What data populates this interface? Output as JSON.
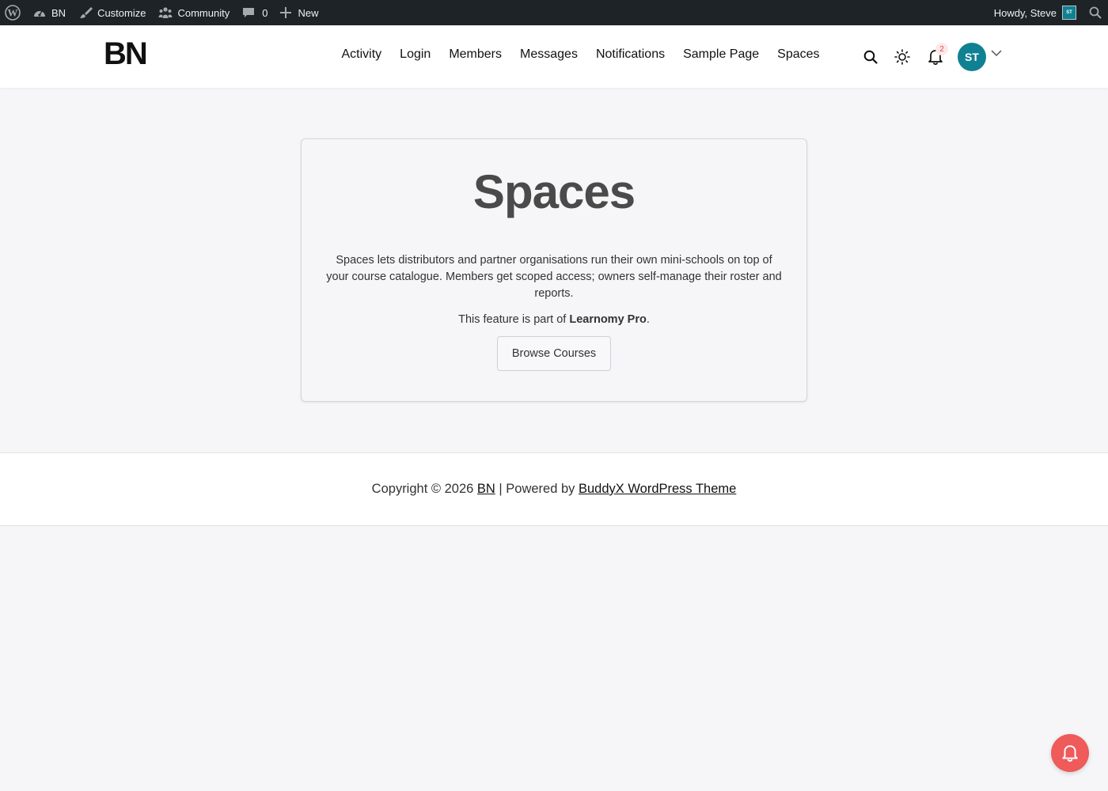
{
  "admin_bar": {
    "site_name": "BN",
    "customize_label": "Customize",
    "community_label": "Community",
    "comments_count": "0",
    "new_label": "New",
    "howdy_text": "Howdy, Steve",
    "avatar_initials": "ST"
  },
  "header": {
    "logo": "BN",
    "nav": [
      "Activity",
      "Login",
      "Members",
      "Messages",
      "Notifications",
      "Sample Page",
      "Spaces"
    ],
    "notifications_count": "2",
    "user_initials": "ST"
  },
  "card": {
    "title": "Spaces",
    "description": "Spaces lets distributors and partner organisations run their own mini-schools on top of your course catalogue. Members get scoped access; owners self-manage their roster and reports.",
    "note_prefix": "This feature is part of ",
    "note_product": "Learnomy Pro",
    "note_suffix": ".",
    "button_label": "Browse Courses"
  },
  "footer": {
    "copyright_prefix": "Copyright © 2026 ",
    "site_link": "BN",
    "separator": " | Powered by ",
    "theme_link": "BuddyX WordPress Theme"
  },
  "colors": {
    "admin_bar_bg": "#1d2327",
    "accent_teal": "#0f8193",
    "fab_red": "#ef5a5a",
    "page_bg": "#f6f6f8"
  },
  "icons": {
    "wordpress": "wordpress-logo-icon",
    "dashboard": "dashboard-gauge-icon",
    "customize": "paintbrush-icon",
    "community": "community-people-icon",
    "comments": "comment-bubble-icon",
    "new": "plus-icon",
    "search": "search-icon",
    "theme": "sun-icon",
    "bell": "bell-icon",
    "chevron": "chevron-down-icon"
  }
}
